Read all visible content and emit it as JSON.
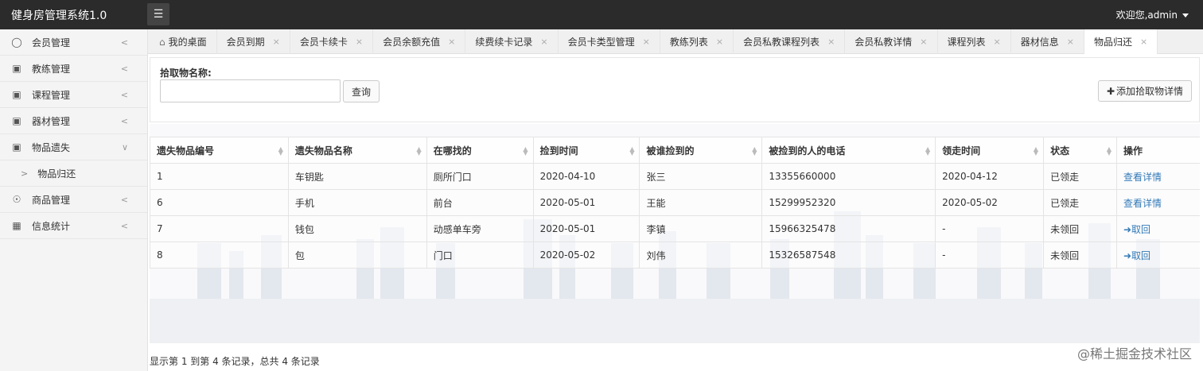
{
  "app": {
    "title": "健身房管理系统1.0",
    "user_greeting": "欢迎您,admin"
  },
  "sidebar": {
    "items": [
      {
        "label": "会员管理",
        "icon": "user-icon"
      },
      {
        "label": "教练管理",
        "icon": "doc-icon"
      },
      {
        "label": "课程管理",
        "icon": "doc-icon"
      },
      {
        "label": "器材管理",
        "icon": "doc-icon"
      },
      {
        "label": "物品遗失",
        "icon": "doc-icon",
        "expanded": true
      },
      {
        "label": "商品管理",
        "icon": "shop-icon"
      },
      {
        "label": "信息统计",
        "icon": "grid-icon"
      }
    ],
    "sub_item": {
      "label": "物品归还"
    }
  },
  "tabs": [
    {
      "label": "我的桌面"
    },
    {
      "label": "会员到期"
    },
    {
      "label": "会员卡续卡"
    },
    {
      "label": "会员余额充值"
    },
    {
      "label": "续费续卡记录"
    },
    {
      "label": "会员卡类型管理"
    },
    {
      "label": "教练列表"
    },
    {
      "label": "会员私教课程列表"
    },
    {
      "label": "会员私教详情"
    },
    {
      "label": "课程列表"
    },
    {
      "label": "器材信息"
    },
    {
      "label": "物品归还",
      "active": true
    }
  ],
  "search": {
    "label": "拾取物名称:",
    "value": "",
    "button": "查询",
    "add_button": "添加拾取物详情"
  },
  "table": {
    "headers": [
      "遗失物品编号",
      "遗失物品名称",
      "在哪找的",
      "捡到时间",
      "被谁捡到的",
      "被捡到的人的电话",
      "领走时间",
      "状态",
      "操作"
    ],
    "rows": [
      {
        "id": "1",
        "name": "车钥匙",
        "where": "厕所门口",
        "found": "2020-04-10",
        "finder": "张三",
        "phone": "13355660000",
        "taken": "2020-04-12",
        "status": "已领走",
        "action": "查看详情"
      },
      {
        "id": "6",
        "name": "手机",
        "where": "前台",
        "found": "2020-05-01",
        "finder": "王能",
        "phone": "15299952320",
        "taken": "2020-05-02",
        "status": "已领走",
        "action": "查看详情"
      },
      {
        "id": "7",
        "name": "钱包",
        "where": "动感单车旁",
        "found": "2020-05-01",
        "finder": "李镇",
        "phone": "15966325478",
        "taken": "-",
        "status": "未领回",
        "action": "取回"
      },
      {
        "id": "8",
        "name": "包",
        "where": "门口",
        "found": "2020-05-02",
        "finder": "刘伟",
        "phone": "15326587548",
        "taken": "-",
        "status": "未领回",
        "action": "取回"
      }
    ]
  },
  "footer": {
    "info": "显示第 1 到第 4 条记录，总共 4 条记录"
  },
  "watermark": "@稀土掘金技术社区"
}
